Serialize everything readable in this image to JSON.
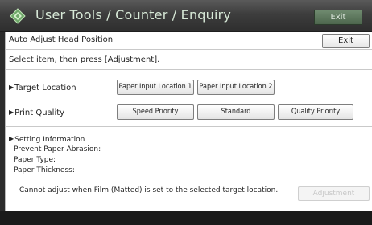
{
  "titlebar": {
    "title": "User Tools / Counter / Enquiry",
    "exit_label": "Exit"
  },
  "panel": {
    "heading": "Auto Adjust Head Position",
    "exit_label": "Exit",
    "instruction": "Select item, then press [Adjustment]."
  },
  "target_location": {
    "label": "Target Location",
    "options": [
      "Paper Input Location 1",
      "Paper Input Location 2"
    ]
  },
  "print_quality": {
    "label": "Print Quality",
    "options": [
      "Speed Priority",
      "Standard",
      "Quality Priority"
    ]
  },
  "setting_info": {
    "heading": "Setting Information",
    "lines": [
      "Prevent Paper Abrasion:",
      "Paper Type:",
      "Paper Thickness:"
    ]
  },
  "note": "Cannot adjust when Film (Matted) is set to the selected target location.",
  "adjustment_label": "Adjustment",
  "colors": {
    "titlebar_bg": "#3d3d3d",
    "title_text": "#d8ead8",
    "title_exit_bg": "#5b775b",
    "footer_bg": "#1a1a1a"
  }
}
